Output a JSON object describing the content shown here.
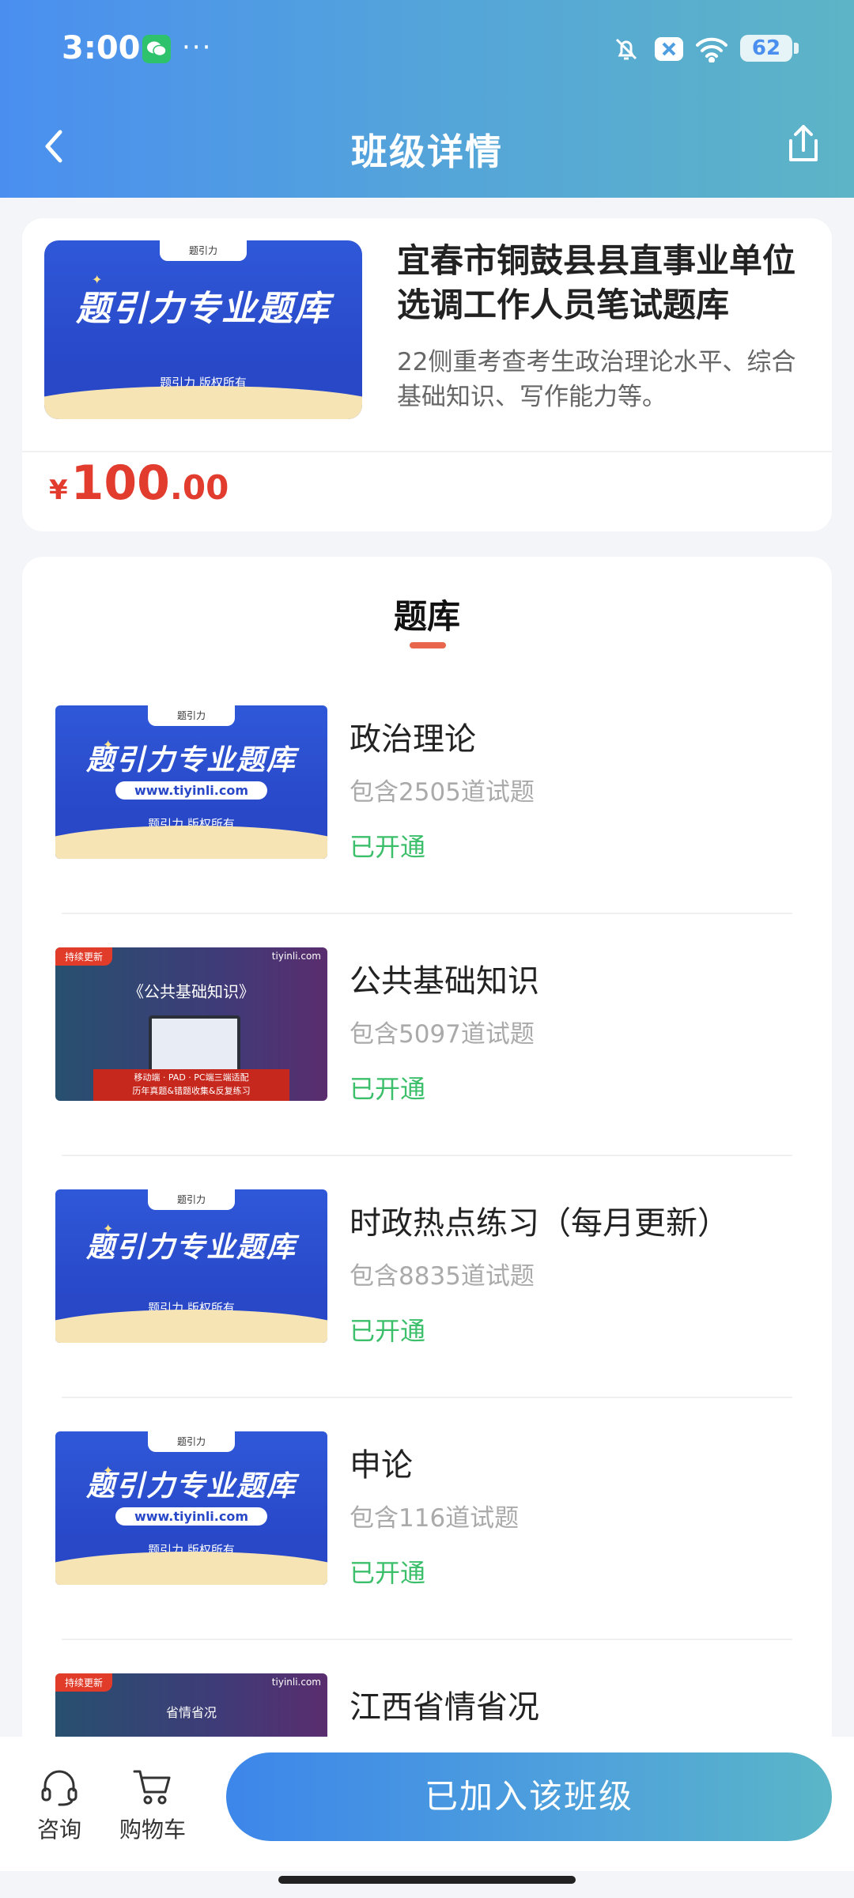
{
  "status_bar": {
    "time": "3:00",
    "battery": "62"
  },
  "nav": {
    "title": "班级详情"
  },
  "course": {
    "thumb_title": "题引力专业题库",
    "thumb_copyright": "题引力 版权所有",
    "thumb_tab": "题引力",
    "title": "宜春市铜鼓县县直事业单位选调工作人员笔试题库",
    "description": "22侧重考查考生政治理论水平、综合基础知识、写作能力等。",
    "price_symbol": "¥",
    "price_int": "100",
    "price_dec": ".00"
  },
  "bank": {
    "heading": "题库",
    "items": [
      {
        "name": "政治理论",
        "count": "包含2505道试题",
        "status": "已开通",
        "thumb": "blue",
        "thumb_title": "题引力专业题库",
        "thumb_url": "www.tiyinli.com",
        "thumb_copy": "题引力 版权所有",
        "thumb_tab": "题引力"
      },
      {
        "name": "公共基础知识",
        "count": "包含5097道试题",
        "status": "已开通",
        "thumb": "purple",
        "thumb_tag": "持续更新",
        "thumb_brand": "tiyinli.com",
        "thumb_title": "《公共基础知识》",
        "thumb_banner1": "移动端 · PAD · PC端三端适配",
        "thumb_banner2": "历年真题&错题收集&反复练习"
      },
      {
        "name": "时政热点练习（每月更新）",
        "count": "包含8835道试题",
        "status": "已开通",
        "thumb": "blue",
        "thumb_title": "题引力专业题库",
        "thumb_copy": "题引力 版权所有",
        "thumb_tab": "题引力"
      },
      {
        "name": "申论",
        "count": "包含116道试题",
        "status": "已开通",
        "thumb": "blue",
        "thumb_title": "题引力专业题库",
        "thumb_url": "www.tiyinli.com",
        "thumb_copy": "题引力 版权所有",
        "thumb_tab": "题引力"
      },
      {
        "name": "江西省情省况",
        "count": "",
        "status": "",
        "thumb": "purple",
        "thumb_tag": "持续更新",
        "thumb_brand": "tiyinli.com",
        "thumb_title": "省情省况"
      }
    ]
  },
  "bottom_bar": {
    "consult_label": "咨询",
    "cart_label": "购物车",
    "join_label": "已加入该班级"
  }
}
